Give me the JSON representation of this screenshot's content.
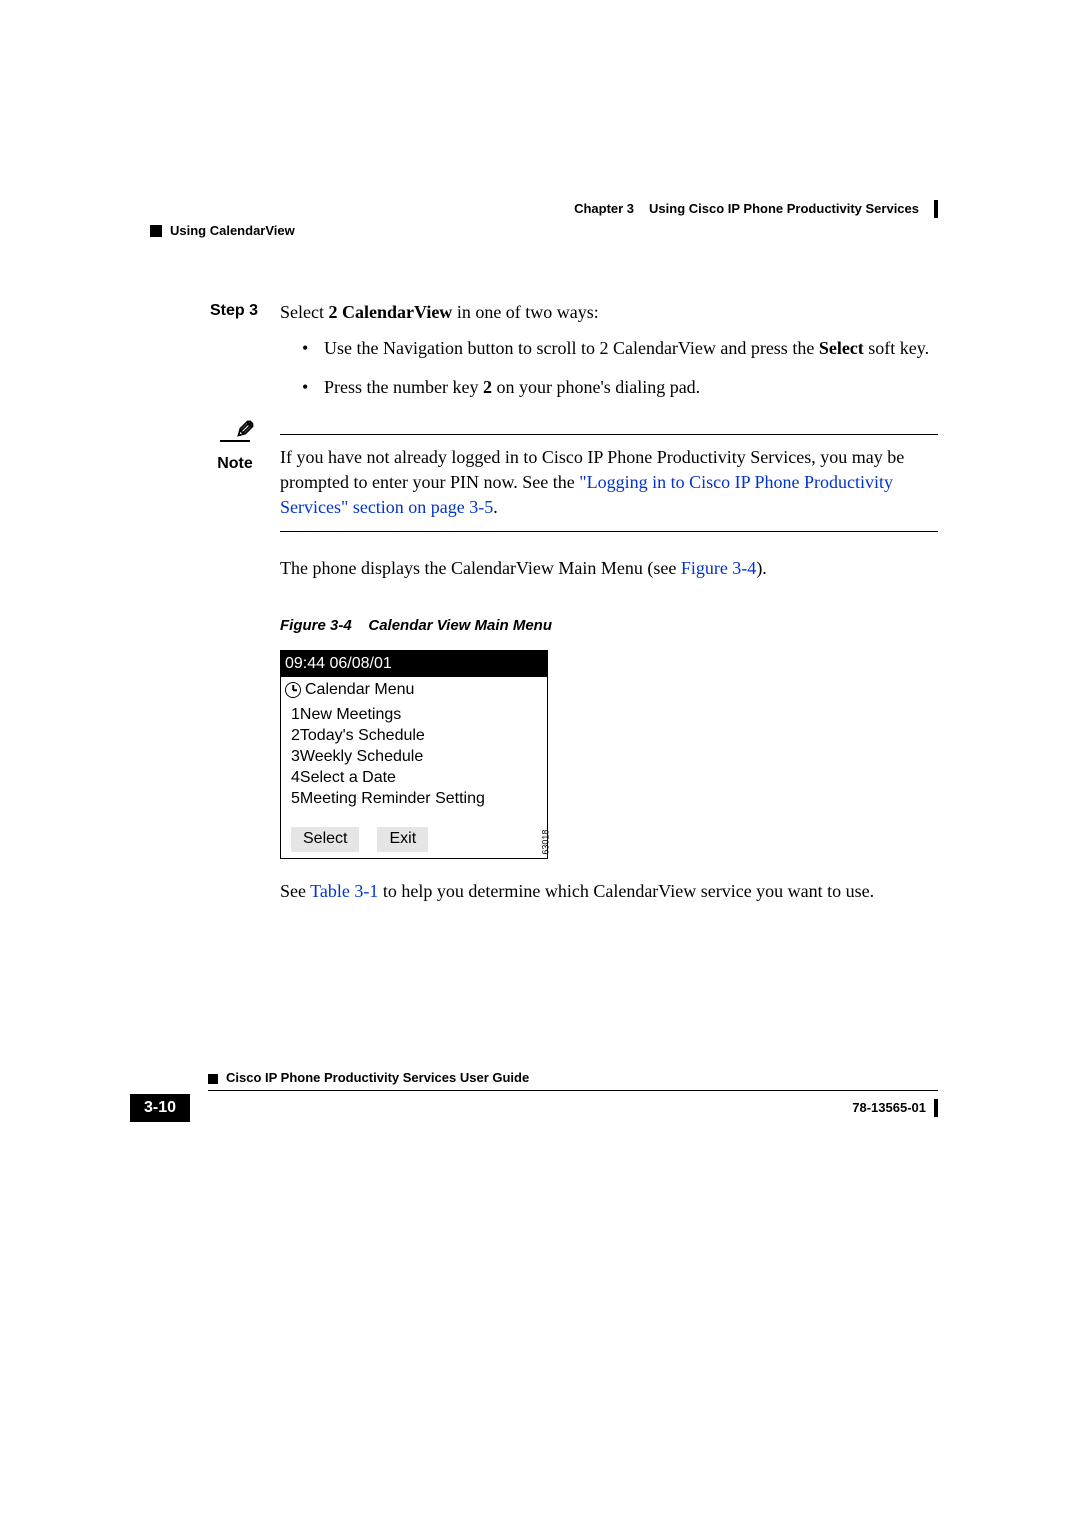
{
  "header": {
    "chapter": "Chapter 3",
    "chapter_title": "Using Cisco IP Phone Productivity Services",
    "section": "Using CalendarView"
  },
  "step": {
    "label": "Step 3",
    "intro_pre": "Select ",
    "intro_bold": "2 CalendarView",
    "intro_post": " in one of two ways:",
    "bullets": [
      {
        "pre": "Use the Navigation button to scroll to 2 CalendarView and press the ",
        "bold": "Select",
        "post": " soft key."
      },
      {
        "pre": "Press the number key ",
        "bold": "2",
        "post": " on your phone's dialing pad."
      }
    ]
  },
  "note": {
    "label": "Note",
    "text_pre": "If you have not already logged in to Cisco IP Phone Productivity Services, you may be prompted to enter your PIN now. See the ",
    "link": "\"Logging in to Cisco IP Phone Productivity Services\" section on page 3-5",
    "text_post": "."
  },
  "para1": {
    "pre": "The phone displays the CalendarView Main Menu (see ",
    "link": "Figure 3-4",
    "post": ")."
  },
  "figure": {
    "caption_num": "Figure 3-4",
    "caption_title": "Calendar View Main Menu",
    "screen": {
      "title": "09:44 06/08/01",
      "header": "Calendar Menu",
      "items": [
        "1New Meetings",
        "2Today's Schedule",
        "3Weekly Schedule",
        "4Select a Date",
        "5Meeting Reminder Setting"
      ],
      "buttons": [
        "Select",
        "Exit"
      ],
      "id": "63018"
    }
  },
  "para2": {
    "pre": "See ",
    "link": "Table 3-1",
    "post": " to help you determine which CalendarView service you want to use."
  },
  "footer": {
    "guide_title": "Cisco IP Phone Productivity Services User Guide",
    "page_num": "3-10",
    "doc_num": "78-13565-01"
  }
}
